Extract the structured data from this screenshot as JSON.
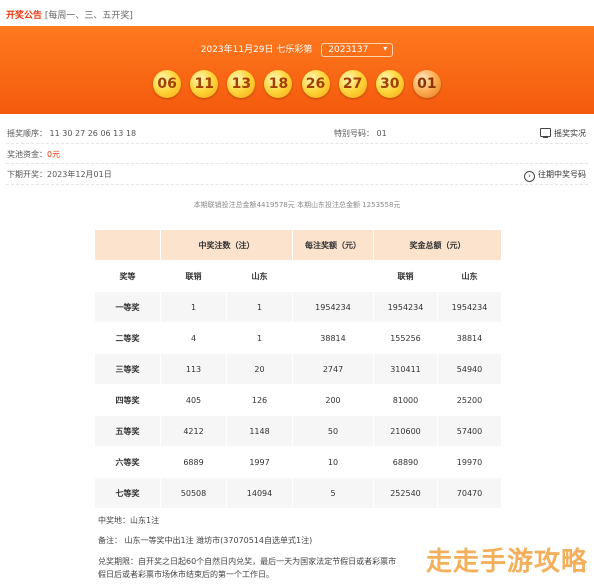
{
  "header_note": {
    "tag": "开奖公告",
    "schedule": "[每周一、三、五开奖]"
  },
  "banner": {
    "date_text": "2023年11月29日 七乐彩第",
    "issue": "2023137",
    "issue_arrow": "▾",
    "basic_numbers": [
      "06",
      "11",
      "13",
      "18",
      "26",
      "27",
      "30"
    ],
    "special_number": "01"
  },
  "draw_info": {
    "order_label": "摇奖顺序：",
    "order_value": "11  30  27  26  06  13  18",
    "special_label": "特别号码：",
    "special_value": "01",
    "video_link": "摇奖实况",
    "pool_label": "奖池资金：",
    "pool_value": "0元",
    "next_label": "下期开奖：",
    "next_value": "2023年12月01日",
    "history_link": "往期中奖号码"
  },
  "sales_text": "本期联销投注总金额4419578元 本期山东投注总金额 1253558元",
  "table": {
    "h_count": "中奖注数（注）",
    "h_per": "每注奖额（元）",
    "h_total": "奖金总额（元）",
    "h_level": "奖等",
    "h_lian": "联销",
    "h_sd": "山东",
    "h_lian2": "联销",
    "h_sd2": "山东",
    "rows": [
      {
        "level": "一等奖",
        "lian": "1",
        "sd": "1",
        "per": "1954234",
        "tot_lian": "1954234",
        "tot_sd": "1954234"
      },
      {
        "level": "二等奖",
        "lian": "4",
        "sd": "1",
        "per": "38814",
        "tot_lian": "155256",
        "tot_sd": "38814"
      },
      {
        "level": "三等奖",
        "lian": "113",
        "sd": "20",
        "per": "2747",
        "tot_lian": "310411",
        "tot_sd": "54940"
      },
      {
        "level": "四等奖",
        "lian": "405",
        "sd": "126",
        "per": "200",
        "tot_lian": "81000",
        "tot_sd": "25200"
      },
      {
        "level": "五等奖",
        "lian": "4212",
        "sd": "1148",
        "per": "50",
        "tot_lian": "210600",
        "tot_sd": "57400"
      },
      {
        "level": "六等奖",
        "lian": "6889",
        "sd": "1997",
        "per": "10",
        "tot_lian": "68890",
        "tot_sd": "19970"
      },
      {
        "level": "七等奖",
        "lian": "50508",
        "sd": "14094",
        "per": "5",
        "tot_lian": "252540",
        "tot_sd": "70470"
      }
    ]
  },
  "notes": {
    "location": "中奖地：山东1注",
    "remark": "备注：  山东一等奖中出1注 潍坊市(37070514自选单式1注)",
    "deadline_1": "兑奖期限：自开奖之日起60个自然日内兑奖，最后一天为国家法定节假日或者彩票市",
    "deadline_2": "假日后或者彩票市场休市结束后的第一个工作日。"
  },
  "watermark": "走走手游攻略"
}
